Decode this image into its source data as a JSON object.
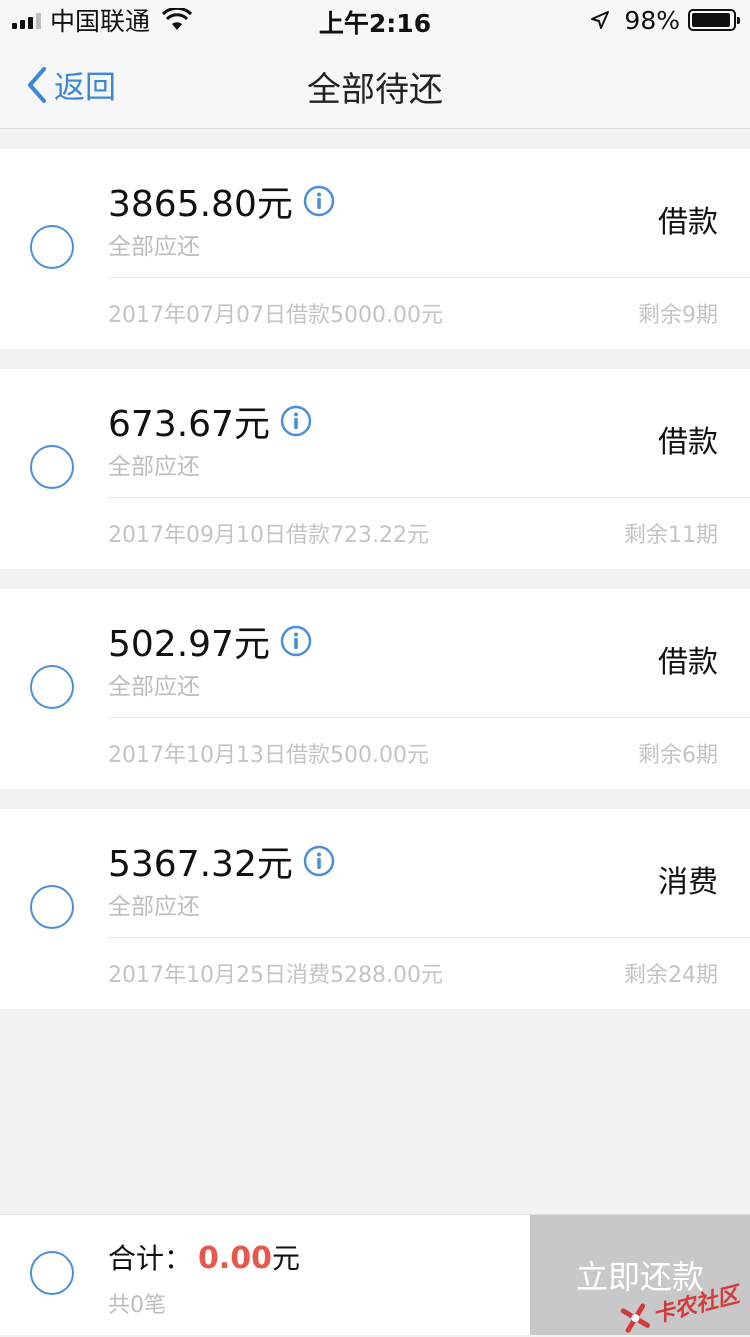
{
  "status_bar": {
    "carrier": "中国联通",
    "time": "上午2:16",
    "battery": "98%"
  },
  "nav": {
    "back_label": "返回",
    "title": "全部待还"
  },
  "items": [
    {
      "amount": "3865.80元",
      "sub": "全部应还",
      "type": "借款",
      "detail": "2017年07月07日借款5000.00元",
      "remaining": "剩余9期"
    },
    {
      "amount": "673.67元",
      "sub": "全部应还",
      "type": "借款",
      "detail": "2017年09月10日借款723.22元",
      "remaining": "剩余11期"
    },
    {
      "amount": "502.97元",
      "sub": "全部应还",
      "type": "借款",
      "detail": "2017年10月13日借款500.00元",
      "remaining": "剩余6期"
    },
    {
      "amount": "5367.32元",
      "sub": "全部应还",
      "type": "消费",
      "detail": "2017年10月25日消费5288.00元",
      "remaining": "剩余24期"
    }
  ],
  "footer": {
    "total_label": "合计：",
    "total_value": "0.00",
    "total_unit": "元",
    "count": "共0笔",
    "pay_button": "立即还款",
    "watermark": "卡农社区"
  },
  "colors": {
    "accent": "#3c87d6",
    "total": "#e8574c",
    "button_disabled": "#c8c8c8"
  }
}
